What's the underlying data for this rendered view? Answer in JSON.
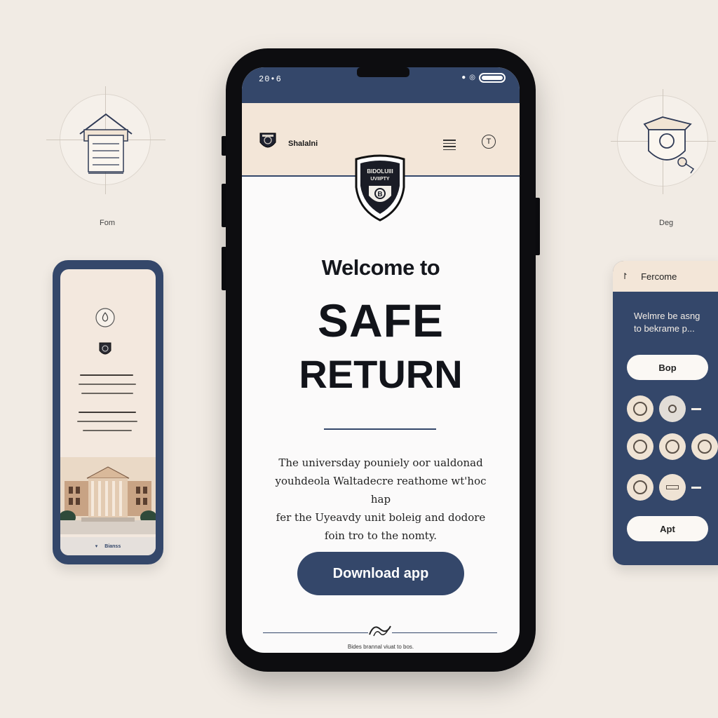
{
  "captions": {
    "left": "Fom",
    "right": "Deg"
  },
  "left_phone": {
    "footer_label": "Bianss"
  },
  "right_card": {
    "title": "Fercome",
    "text_line1": "Welmre be asng",
    "text_line2": "to bekrame p...",
    "pill_top": "Bop",
    "pill_bottom": "Apt"
  },
  "main_phone": {
    "status_time": "20•6",
    "header_title": "Shalalni",
    "info_glyph": "T",
    "crest_text_line1": "BIDOLUIII",
    "crest_text_line2": "UVIIPTY",
    "welcome": "Welcome to",
    "brand_line1": "SAFE",
    "brand_line2": "RETURN",
    "description": [
      "The universday pouniely oor ualdonad",
      "youhdeola Waltadecre reathome wt'hoc hap",
      "fer the Uyeavdy unit boleig and dodore",
      "foin tro to the nomty."
    ],
    "download_button": "Download app",
    "footer_text": "Bides brannal viuat to bos."
  },
  "colors": {
    "navy": "#34476a",
    "cream": "#f3e6d8",
    "background": "#f1ebe4",
    "phone_frame": "#0d0d10"
  }
}
